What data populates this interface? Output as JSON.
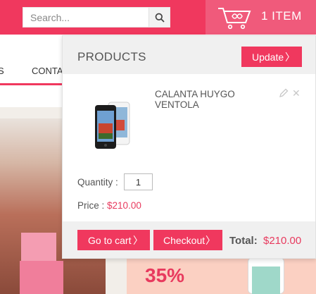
{
  "header": {
    "search_placeholder": "Search...",
    "cart_count_label": "1 ITEM"
  },
  "nav": {
    "partial_item": "S",
    "contact": "CONTA"
  },
  "promo": {
    "text": "35%"
  },
  "cart": {
    "title": "PRODUCTS",
    "update_label": "Update",
    "arrow": "〉",
    "item": {
      "name": "CALANTA HUYGO VENTOLA",
      "quantity_label": "Quantity :",
      "quantity": "1",
      "price_label": "Price :",
      "price": "$210.00"
    },
    "goto_cart_label": "Go to cart",
    "checkout_label": "Checkout",
    "total_label": "Total:",
    "total_value": "$210.00"
  },
  "colors": {
    "accent": "#f0385e",
    "accent_light": "#f05a7b",
    "panel_bg": "#f0f0f0"
  },
  "icons": [
    "search-icon",
    "cart-icon",
    "edit-icon",
    "close-icon",
    "chevron-right-icon"
  ]
}
